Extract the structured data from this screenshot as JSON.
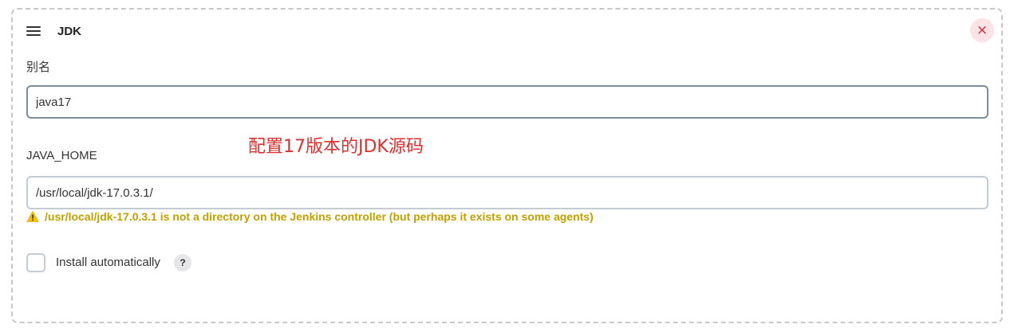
{
  "section": {
    "title": "JDK",
    "close_symbol": "×",
    "drag_icon": "hamburger-icon"
  },
  "alias": {
    "label": "别名",
    "value": "java17"
  },
  "annotation": {
    "text": "配置17版本的JDK源码",
    "color": "#e02f2f"
  },
  "java_home": {
    "label": "JAVA_HOME",
    "value": "/usr/local/jdk-17.0.3.1/",
    "warning": "/usr/local/jdk-17.0.3.1 is not a directory on the Jenkins controller (but perhaps it exists on some agents)",
    "warning_color": "#c2a000"
  },
  "install": {
    "label": "Install automatically",
    "checked": false,
    "help_symbol": "?"
  }
}
